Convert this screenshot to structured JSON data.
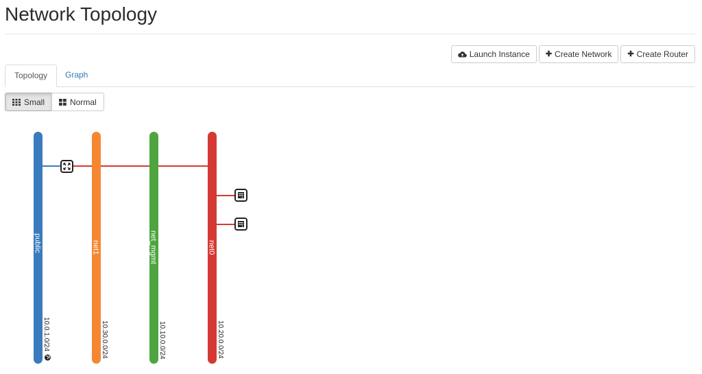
{
  "header": {
    "title": "Network Topology"
  },
  "actions": {
    "launch_instance": {
      "label": "Launch Instance",
      "icon": "cloud-upload-icon"
    },
    "create_network": {
      "label": "Create Network",
      "icon": "plus-icon"
    },
    "create_router": {
      "label": "Create Router",
      "icon": "plus-icon"
    }
  },
  "tabs": [
    {
      "label": "Topology",
      "active": true
    },
    {
      "label": "Graph",
      "active": false
    }
  ],
  "size_toggle": {
    "small_label": "Small",
    "normal_label": "Normal",
    "selected": "Small"
  },
  "networks": [
    {
      "name": "public",
      "cidr": "10.0.1.0/24",
      "color": "#3a7bbd",
      "external": true
    },
    {
      "name": "net1",
      "cidr": "10.30.0.0/24",
      "color": "#f58733",
      "external": false
    },
    {
      "name": "net_mgmt",
      "cidr": "10.10.0.0/24",
      "color": "#4ea53f",
      "external": false
    },
    {
      "name": "net0",
      "cidr": "10.20.0.0/24",
      "color": "#d43a33",
      "external": false
    }
  ],
  "router": {
    "icon": "router-icon",
    "uplink_color": "#3a7bbd",
    "link_color": "#d43a33"
  },
  "instances": [
    {
      "icon": "server-icon",
      "network": "net0"
    },
    {
      "icon": "server-icon",
      "network": "net0"
    }
  ],
  "colors": {
    "link_blue": "#337ab7",
    "border": "#cccccc"
  }
}
